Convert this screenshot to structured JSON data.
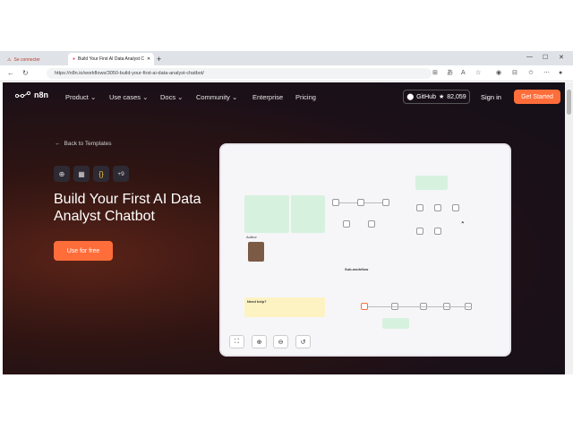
{
  "browser": {
    "tab_inactive_label": "Se connecter",
    "tab_active_label": "Build Your First AI Data Analyst C",
    "new_tab": "+",
    "url": "https://n8n.io/workflows/3050-build-your-first-ai-data-analyst-chatbot/"
  },
  "nav": {
    "logo_text": "n8n",
    "items": [
      "Product",
      "Use cases",
      "Docs",
      "Community",
      "Enterprise",
      "Pricing"
    ],
    "github_label": "GitHub",
    "github_stars": "82,059",
    "signin": "Sign in",
    "get_started": "Get Started"
  },
  "hero": {
    "back_link": "Back to Templates",
    "more_apps": "+9",
    "title": "Build Your First AI Data Analyst Chatbot",
    "cta": "Use for free"
  },
  "preview": {
    "author_label": "Author",
    "help_label": "Need help?",
    "subworkflow_label": "Sub-workflow"
  },
  "colors": {
    "accent": "#ff6d3a"
  }
}
